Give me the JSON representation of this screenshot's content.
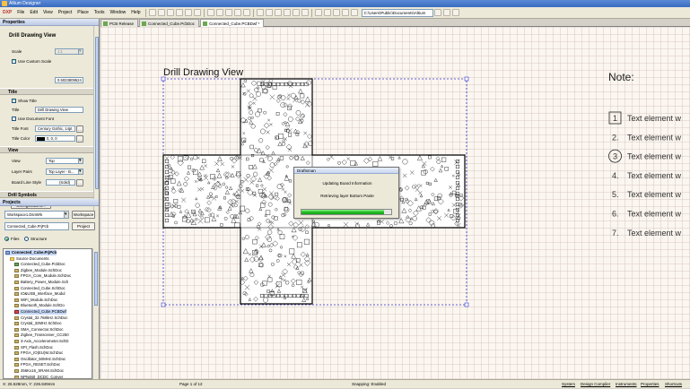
{
  "window": {
    "title": "Altium Designer"
  },
  "menu": [
    "DXP",
    "File",
    "Edit",
    "View",
    "Project",
    "Place",
    "Tools",
    "Window",
    "Help"
  ],
  "toolbar": {
    "path": "C:\\Users\\Public\\Documents\\Altium"
  },
  "doc_tabs": [
    {
      "label": "PCB Release",
      "active": false
    },
    {
      "label": "Connected_Cube.PcbDoc",
      "active": false
    },
    {
      "label": "Connected_Cube.PCBDwf *",
      "active": true
    }
  ],
  "properties": {
    "panel_title": "Properties",
    "heading": "Drill Drawing View",
    "scale_label": "Scale",
    "scale_value": "1:1",
    "use_custom_scale": "Use Custom Scale",
    "custom_scale_value": "0.5023809524",
    "title_section": "Title",
    "show_title": "Show Title",
    "title_label": "Title",
    "title_value": "Drill Drawing View",
    "use_document_font": "Use Document Font",
    "title_font_label": "Title Font",
    "title_font_value": "Century Gothic, 14pt",
    "title_color_label": "Title Color",
    "title_color_value": "0, 0, 0",
    "view_section": "View",
    "view_label": "View",
    "view_value": "Top",
    "layer_pairs_label": "Layer Pairs",
    "layer_pairs_value": "Top Layer - B...",
    "board_line_label": "Board Line Style",
    "board_line_value": "(Solid)",
    "drill_symbols_section": "Drill Symbols",
    "configurations_button": "Configurations...",
    "ellipsis": "..."
  },
  "projects": {
    "panel_title": "Projects",
    "workspace_value": "Workspace1.DsnWrk",
    "workspace_button": "Workspace",
    "project_value": "Connected_Cube.PrjPcb",
    "project_button": "Project",
    "files_label": "Files",
    "structure_label": "Structure",
    "tree": [
      {
        "label": "Connected_Cube.PrjPcb",
        "icon": "proj",
        "indent": 0
      },
      {
        "label": "Source Documents",
        "icon": "folder",
        "indent": 1
      },
      {
        "label": "Connected_Cube.PcbDoc",
        "icon": "pcb",
        "indent": 2
      },
      {
        "label": "Zigbee_Module.SchDoc",
        "icon": "sch",
        "indent": 2
      },
      {
        "label": "FPGA_Core_Module.SchDoc",
        "icon": "sch",
        "indent": 2
      },
      {
        "label": "Battery_Power_Module.Sch",
        "icon": "sch",
        "indent": 2
      },
      {
        "label": "Connected_Cube.SchDoc",
        "icon": "sch",
        "indent": 2
      },
      {
        "label": "IO&USB_Interface_Modul",
        "icon": "sch",
        "indent": 2
      },
      {
        "label": "WiFi_Module.SchDoc",
        "icon": "sch",
        "indent": 2
      },
      {
        "label": "Bluetooth_Module.SchDo",
        "icon": "sch",
        "indent": 2
      },
      {
        "label": "Connected_Cube.PCBDwf",
        "icon": "red",
        "indent": 2
      },
      {
        "label": "Crystal_32.768kHz.SchDoc",
        "icon": "sch",
        "indent": 2
      },
      {
        "label": "Crystal_32MHz.SchDoc",
        "icon": "sch",
        "indent": 2
      },
      {
        "label": "SMA_Connector.SchDoc",
        "icon": "sch",
        "indent": 2
      },
      {
        "label": "Zigbee_Transceiver_CC250",
        "icon": "sch",
        "indent": 2
      },
      {
        "label": "3-Axis_Accelerometer.SchD",
        "icon": "sch",
        "indent": 2
      },
      {
        "label": "SPI_Flash.SchDoc",
        "icon": "sch",
        "indent": 2
      },
      {
        "label": "FPGA_IO(EU)M.SchDoc",
        "icon": "sch",
        "indent": 2
      },
      {
        "label": "Oscillator_50MHz.SchDoc",
        "icon": "sch",
        "indent": 2
      },
      {
        "label": "FPGA_RESET.SchDoc",
        "icon": "sch",
        "indent": 2
      },
      {
        "label": "256Kx16_SRAM.SchDoc",
        "icon": "sch",
        "indent": 2
      },
      {
        "label": "NPN460_DCDC_Conver",
        "icon": "sch",
        "indent": 2
      }
    ]
  },
  "drawing": {
    "view_title": "Drill Drawing View",
    "note_title": "Note:",
    "notes": [
      {
        "num": "1",
        "text": "Text element w",
        "style": "box"
      },
      {
        "num": "2.",
        "text": "Text element w",
        "style": "plain"
      },
      {
        "num": "3",
        "text": "Text element w",
        "style": "circle"
      },
      {
        "num": "4.",
        "text": "Text element w",
        "style": "plain"
      },
      {
        "num": "5.",
        "text": "Text element w",
        "style": "plain"
      },
      {
        "num": "6.",
        "text": "Text element w",
        "style": "plain"
      },
      {
        "num": "7.",
        "text": "Text element w",
        "style": "plain"
      }
    ]
  },
  "dialog": {
    "title": "Draftsman",
    "line1": "Updating Board Information",
    "line2": "Retrieving layer Bottom Paste",
    "progress": 0.92
  },
  "status": {
    "coords": "X: 26.528mm, Y: 226.849mm",
    "page": "Page 1 of 12",
    "snapping": "Snapping: Enabled",
    "right_items": [
      "System",
      "Design Compiler",
      "Instruments",
      "Properties",
      "Shortcuts"
    ]
  },
  "colors": {
    "accent": "#3a6cc0",
    "progress": "#22c022",
    "board_outline": "#000000",
    "selection": "#3333cc"
  }
}
